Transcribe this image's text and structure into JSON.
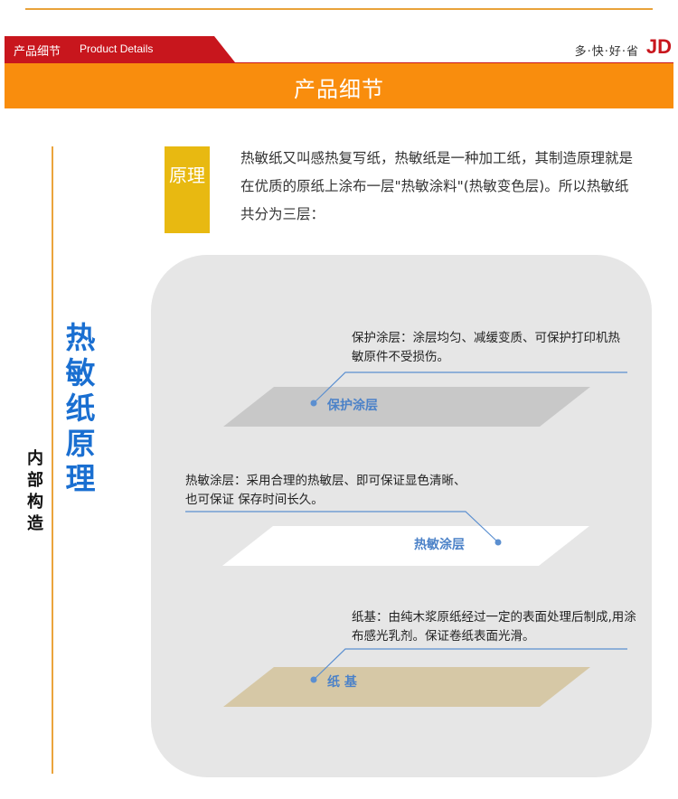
{
  "header": {
    "tab_cn": "产品细节",
    "tab_en": "Product Details",
    "slogan": "多·快·好·省",
    "logo": "JD",
    "band_title": "产品细节"
  },
  "side": {
    "label": "内部构造",
    "title": "热敏纸原理"
  },
  "principle": {
    "badge": "原理",
    "text": "热敏纸又叫感热复写纸，热敏纸是一种加工纸，其制造原理就是在优质的原纸上涂布一层\"热敏涂料\"(热敏变色层)。所以热敏纸共分为三层："
  },
  "layers": [
    {
      "name": "保护涂层",
      "desc": "保护涂层：涂层均匀、减缓变质、可保护打印机热敏原件不受损伤。",
      "color": "#c8c8c8"
    },
    {
      "name": "热敏涂层",
      "desc": "热敏涂层：采用合理的热敏层、即可保证显色清晰、也可保证 保存时间长久。",
      "color": "#ffffff"
    },
    {
      "name": "纸 基",
      "desc": "纸基：由纯木浆原纸经过一定的表面处理后制成,用涂布感光乳剂。保证卷纸表面光滑。",
      "color": "#d6c8a6"
    }
  ],
  "colors": {
    "accent_red": "#c8161d",
    "band_orange": "#f98d0d",
    "badge_yellow": "#e8b911",
    "title_blue": "#1a6fd1",
    "connector_blue": "#5b8fd0"
  }
}
